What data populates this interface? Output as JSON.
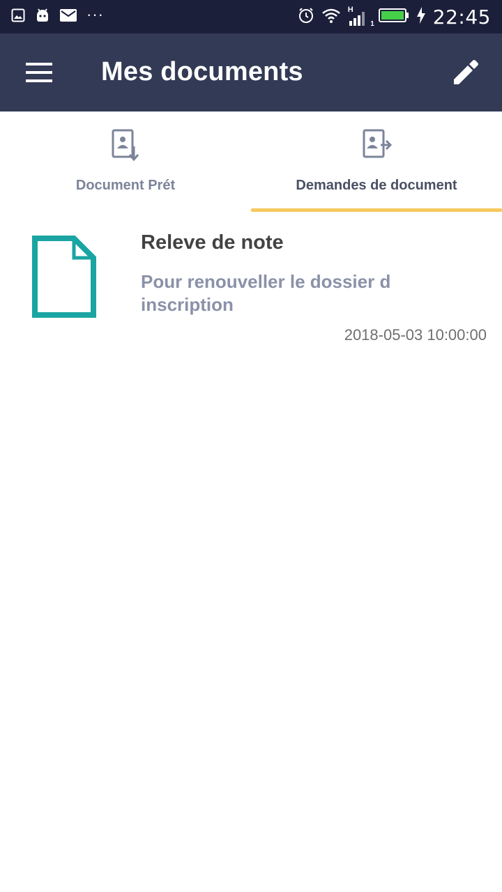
{
  "status_bar": {
    "time": "22:45",
    "overflow": "···",
    "network": "H",
    "sim": "1",
    "icons": [
      "image-icon",
      "android-icon",
      "mail-icon",
      "alarm-icon",
      "wifi-icon",
      "signal-icon",
      "battery-icon",
      "charging-icon"
    ]
  },
  "app_bar": {
    "title": "Mes documents",
    "menu_icon": "hamburger-menu-icon",
    "action_icon": "edit-pencil-icon"
  },
  "tabs": [
    {
      "label": "Document Prét",
      "icon": "document-download-icon",
      "selected": false
    },
    {
      "label": "Demandes de document",
      "icon": "document-send-icon",
      "selected": true
    }
  ],
  "documents": [
    {
      "title": "Releve de note",
      "description": "Pour renouveller le dossier d inscription",
      "date": "2018-05-03 10:00:00",
      "icon": "document-file-icon"
    }
  ],
  "colors": {
    "status_bar": "#1b1f3a",
    "app_bar": "#323a55",
    "accent": "#f6c85f",
    "doc_icon": "#1aa5a2",
    "tab_icon": "#7c849a"
  }
}
